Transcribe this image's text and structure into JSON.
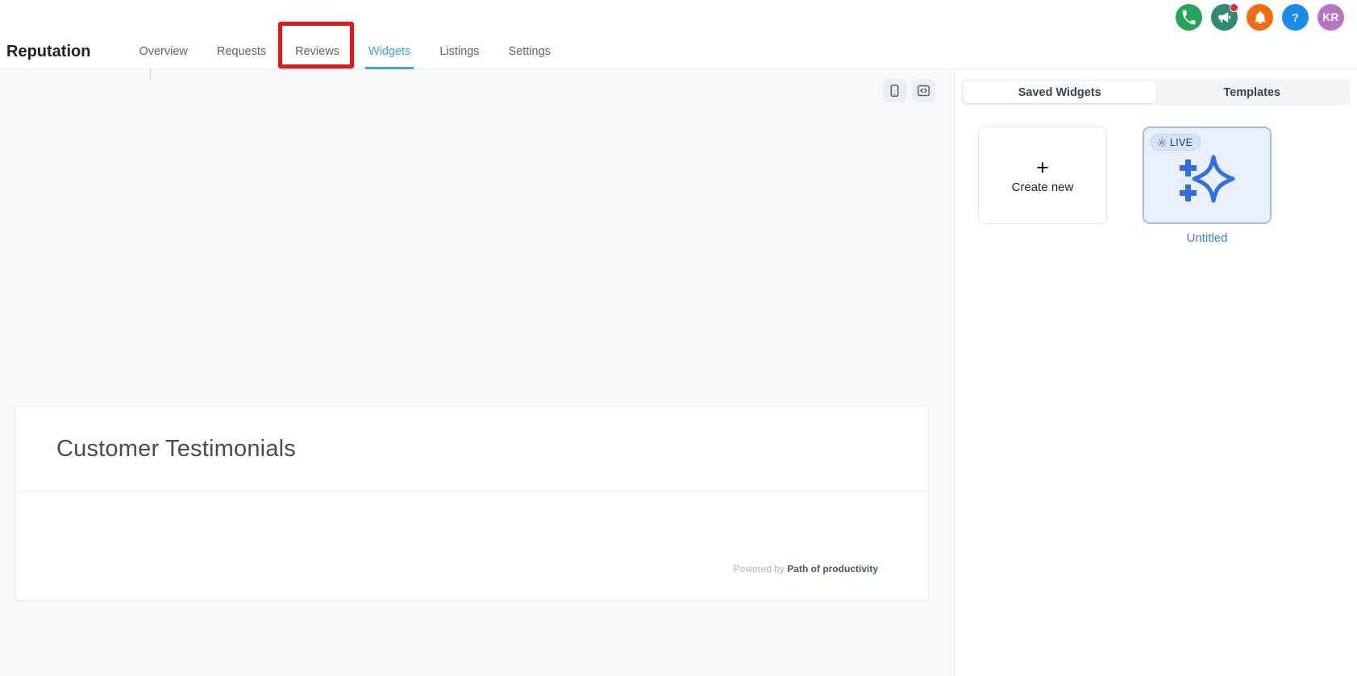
{
  "topbar": {
    "icons": [
      {
        "name": "phone-icon",
        "title": "Calls",
        "color": "#27a35a"
      },
      {
        "name": "megaphone-icon",
        "title": "Announcements",
        "color": "#2e8a72",
        "badge": true
      },
      {
        "name": "bell-icon",
        "title": "Notifications",
        "color": "#f26b0f"
      },
      {
        "name": "help-icon",
        "title": "Help",
        "color": "#1a8cf0"
      }
    ],
    "avatar_initials": "KR"
  },
  "appnav": {
    "brand": "Reputation",
    "items": [
      {
        "label": "Overview",
        "active": false
      },
      {
        "label": "Requests",
        "active": false
      },
      {
        "label": "Reviews",
        "active": false
      },
      {
        "label": "Widgets",
        "active": true
      },
      {
        "label": "Listings",
        "active": false
      },
      {
        "label": "Settings",
        "active": false
      }
    ],
    "active_item": "Widgets",
    "accent_color": "#3ca2dd",
    "highlight_color": "#ef1313"
  },
  "stage": {
    "toolbar": [
      {
        "name": "mobile-preview-icon",
        "label": "Mobile preview"
      },
      {
        "name": "embed-code-icon",
        "label": "Embed code"
      }
    ]
  },
  "widget_preview": {
    "title": "Customer Testimonials",
    "powered_prefix": "Powered by",
    "powered_brand": "Path of productivity"
  },
  "rightpanel": {
    "tabs": [
      {
        "label": "Saved Widgets",
        "active": true
      },
      {
        "label": "Templates",
        "active": false
      }
    ],
    "create_new": {
      "plus": "+",
      "label": "Create new"
    },
    "templates": [
      {
        "name": "Untitled",
        "badge": "LIVE",
        "badge_icon": "sun-icon",
        "art_icon": "sparkle-icon",
        "selected": true
      }
    ]
  },
  "colors": {
    "accent": "#3ca2dd",
    "template_blue": "#3d7fe0",
    "stage_bg": "#f7f8fa",
    "panel_bg": "#ffffff"
  }
}
